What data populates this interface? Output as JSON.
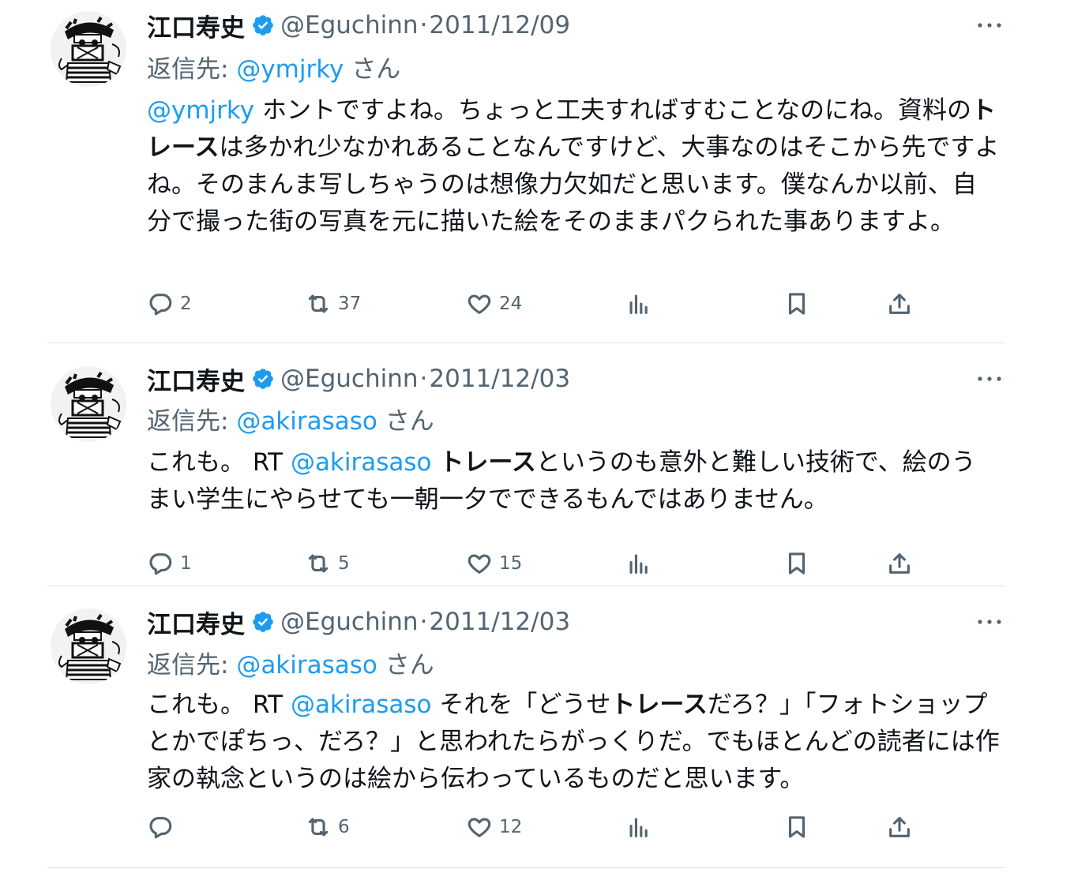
{
  "tweets": [
    {
      "name": "江口寿史",
      "handle": "@Eguchinn",
      "dot": "·",
      "date": "2011/12/09",
      "reply_prefix": "返信先: ",
      "reply_handle": "@ymjrky",
      "reply_suffix": " さん",
      "body": [
        {
          "t": "@ymjrky",
          "s": "link"
        },
        {
          "t": " ホントですよね。ちょっと工夫すればすむことなのにね。資料の",
          "s": "plain"
        },
        {
          "t": "トレース",
          "s": "bold"
        },
        {
          "t": "は多かれ少なかれあることなんですけど、大事なのはそこから先ですよね。そのまんま写しちゃうのは想像力欠如だと思います。僕なんか以前、自分で撮った街の写真を元に描いた絵をそのままパクられた事ありますよ。",
          "s": "plain"
        }
      ],
      "replies": "2",
      "retweets": "37",
      "likes": "24"
    },
    {
      "name": "江口寿史",
      "handle": "@Eguchinn",
      "dot": "·",
      "date": "2011/12/03",
      "reply_prefix": "返信先: ",
      "reply_handle": "@akirasaso",
      "reply_suffix": " さん",
      "body": [
        {
          "t": "これも。 RT ",
          "s": "plain"
        },
        {
          "t": "@akirasaso",
          "s": "link"
        },
        {
          "t": " ",
          "s": "plain"
        },
        {
          "t": "トレース",
          "s": "bold"
        },
        {
          "t": "というのも意外と難しい技術で、絵のうまい学生にやらせても一朝一夕でできるもんではありません。",
          "s": "plain"
        }
      ],
      "replies": "1",
      "retweets": "5",
      "likes": "15"
    },
    {
      "name": "江口寿史",
      "handle": "@Eguchinn",
      "dot": "·",
      "date": "2011/12/03",
      "reply_prefix": "返信先: ",
      "reply_handle": "@akirasaso",
      "reply_suffix": " さん",
      "body": [
        {
          "t": "これも。 RT ",
          "s": "plain"
        },
        {
          "t": "@akirasaso",
          "s": "link"
        },
        {
          "t": " それを「どうせ",
          "s": "plain"
        },
        {
          "t": "トレース",
          "s": "bold"
        },
        {
          "t": "だろ？」「フォトショップとかでぽちっ、だろ？」と思われたらがっくりだ。でもほとんどの読者には作家の執念というのは絵から伝わっているものだと思います。",
          "s": "plain"
        }
      ],
      "replies": "",
      "retweets": "6",
      "likes": "12"
    }
  ],
  "icons": {
    "verified": "verified-badge-icon",
    "reply": "reply-icon",
    "retweet": "retweet-icon",
    "like": "heart-icon",
    "views": "views-icon",
    "bookmark": "bookmark-icon",
    "share": "share-icon",
    "more": "more-icon"
  },
  "colors": {
    "link": "#1d9bf0",
    "verified": "#1d9bf0",
    "muted": "#536471",
    "text": "#0f1419",
    "divider": "#dfe3e6"
  }
}
